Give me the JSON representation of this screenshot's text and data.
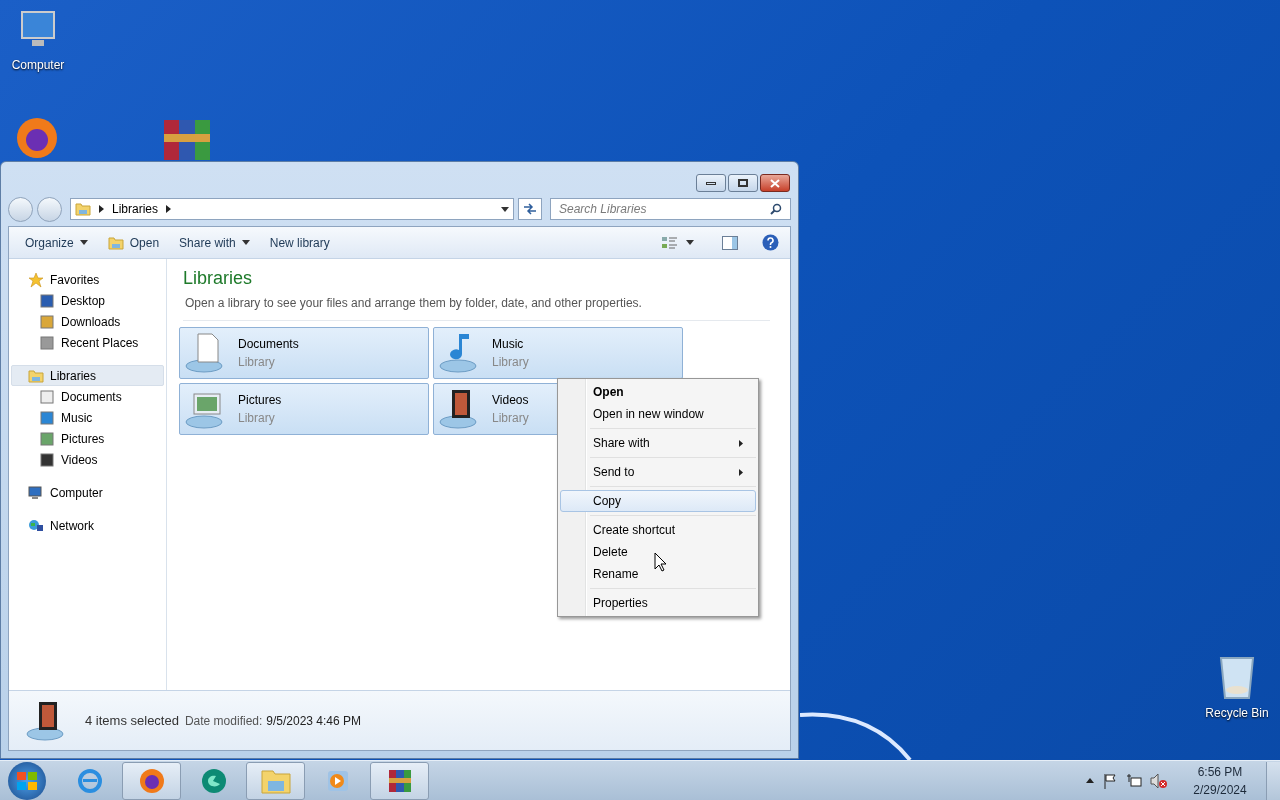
{
  "desktop_icons": [
    {
      "label": "Computer"
    },
    {
      "label": "Recycle Bin"
    }
  ],
  "window": {
    "breadcrumb": "Libraries",
    "search": {
      "placeholder": "Search Libraries"
    },
    "toolbar": [
      {
        "label": "Organize",
        "kind": "menu"
      },
      {
        "label": "Open",
        "kind": "icon"
      },
      {
        "label": "Share with",
        "kind": "menu"
      },
      {
        "label": "New library",
        "kind": "plain"
      }
    ],
    "sidebar": [
      {
        "label": "Favorites",
        "selected": false,
        "children": [
          {
            "label": "Desktop",
            "selected": false
          },
          {
            "label": "Downloads",
            "selected": false
          },
          {
            "label": "Recent Places",
            "selected": false
          }
        ]
      },
      {
        "label": "Libraries",
        "selected": true,
        "children": [
          {
            "label": "Documents",
            "selected": false
          },
          {
            "label": "Music",
            "selected": false
          },
          {
            "label": "Pictures",
            "selected": false
          },
          {
            "label": "Videos",
            "selected": false
          }
        ]
      },
      {
        "label": "Computer",
        "selected": false
      },
      {
        "label": "Network",
        "selected": false
      }
    ],
    "heading": "Libraries",
    "subtitle": "Open a library to see your files and arrange them by folder, date, and other properties.",
    "libraries": [
      {
        "name": "Documents",
        "type": "Library",
        "selected": true
      },
      {
        "name": "Music",
        "type": "Library",
        "selected": true
      },
      {
        "name": "Pictures",
        "type": "Library",
        "selected": true
      },
      {
        "name": "Videos",
        "type": "Library",
        "selected": true
      }
    ],
    "status": {
      "count": "4 items selected",
      "date_label": "Date modified:",
      "date_value": "9/5/2023 4:46 PM"
    }
  },
  "context_menu": [
    [
      {
        "label": "Open",
        "default": true,
        "submenu": false,
        "selected": false
      },
      {
        "label": "Open in new window",
        "default": false,
        "submenu": false,
        "selected": false
      }
    ],
    [
      {
        "label": "Share with",
        "default": false,
        "submenu": true,
        "selected": false
      }
    ],
    [
      {
        "label": "Send to",
        "default": false,
        "submenu": true,
        "selected": false
      }
    ],
    [
      {
        "label": "Copy",
        "default": false,
        "submenu": false,
        "selected": true
      }
    ],
    [
      {
        "label": "Create shortcut",
        "default": false,
        "submenu": false,
        "selected": false
      },
      {
        "label": "Delete",
        "default": false,
        "submenu": false,
        "selected": false
      },
      {
        "label": "Rename",
        "default": false,
        "submenu": false,
        "selected": false
      }
    ],
    [
      {
        "label": "Properties",
        "default": false,
        "submenu": false,
        "selected": false
      }
    ]
  ],
  "taskbar": {
    "apps": [
      {
        "running": false
      },
      {
        "running": true
      },
      {
        "running": false
      },
      {
        "running": true
      },
      {
        "running": false
      },
      {
        "running": true
      }
    ],
    "time": "6:56 PM",
    "date": "2/29/2024"
  }
}
